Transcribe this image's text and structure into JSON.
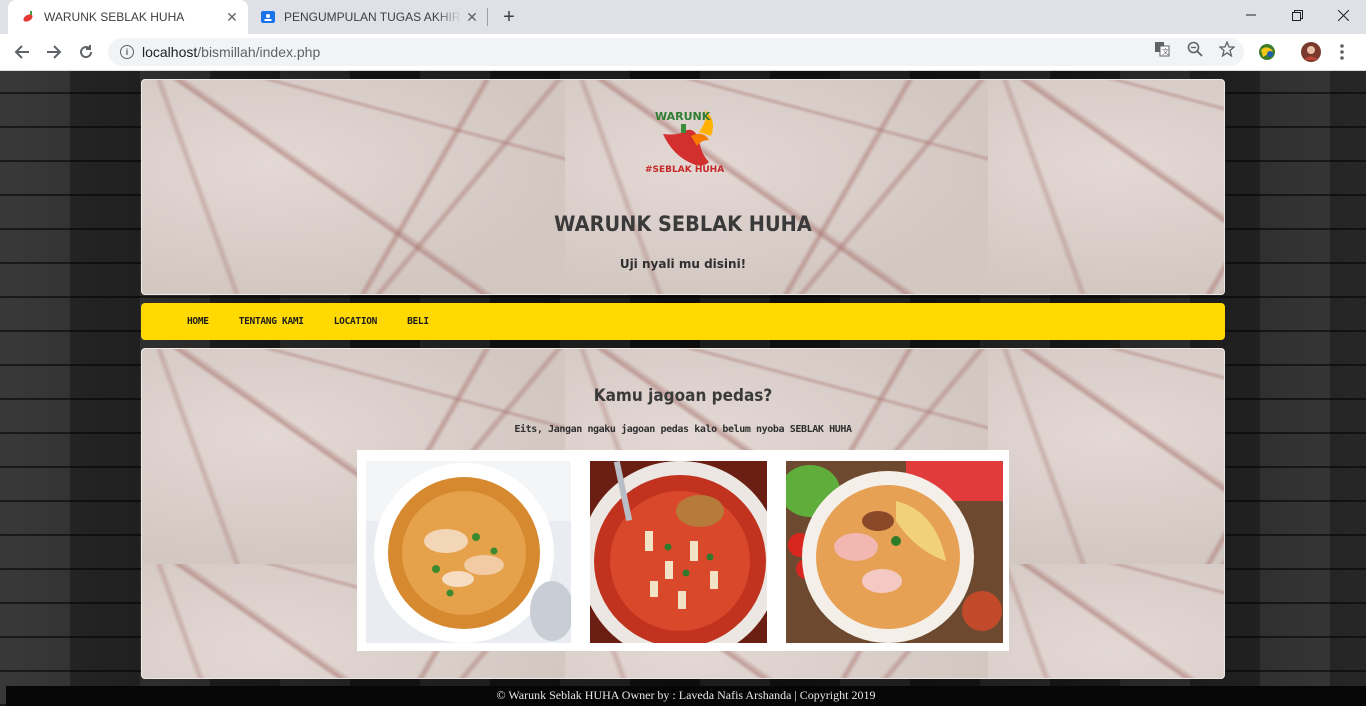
{
  "browser": {
    "tabs": [
      {
        "title": "WARUNK SEBLAK HUHA",
        "active": true,
        "icon": "chili-favicon-icon"
      },
      {
        "title": "PENGUMPULAN TUGAS AKHIR WEB",
        "active": false,
        "icon": "classroom-icon"
      }
    ],
    "address": {
      "host": "localhost",
      "path": "/bismillah/index.php"
    }
  },
  "site": {
    "logo_text_top": "WARUNK",
    "logo_text_bottom": "#SEBLAK HUHA",
    "title": "WARUNK SEBLAK HUHA",
    "tagline": "Uji nyali mu disini!",
    "accent_color": "#ffd900"
  },
  "nav": {
    "items": [
      "HOME",
      "TENTANG KAMI",
      "LOCATION",
      "BELI"
    ]
  },
  "content": {
    "heading": "Kamu jagoan pedas?",
    "subtext": "Eits, Jangan ngaku jagoan pedas kalo belum nyoba SEBLAK HUHA",
    "photos": [
      "seblak-bowl-1",
      "seblak-bowl-2",
      "seblak-bowl-3"
    ]
  },
  "footer": {
    "text": "© Warunk Seblak HUHA Owner by : Laveda Nafis Arshanda | Copyright 2019"
  }
}
